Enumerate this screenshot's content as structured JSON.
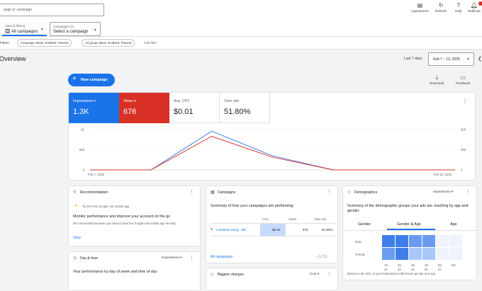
{
  "header": {
    "search_placeholder": "page or campaign",
    "view_selector": {
      "label": "View (2 filters)",
      "value": "All campaigns"
    },
    "campaigns_selector": {
      "label": "Campaigns (1)",
      "value": "Select a campaign"
    },
    "actions": [
      {
        "label": "Appearance",
        "icon": "appearance-icon"
      },
      {
        "label": "Refresh",
        "icon": "refresh-icon"
      },
      {
        "label": "Help",
        "icon": "help-icon"
      },
      {
        "label": "Notificati",
        "icon": "notifications-icon"
      }
    ]
  },
  "filters": {
    "label": "Filters",
    "chips": [
      "Campaign status: Enabled, Paused",
      "Ad group status: Enabled, Paused"
    ],
    "add_filter": "Add filter"
  },
  "overview": {
    "title": "Overview",
    "date_preset": "Last 7 days",
    "date_range": "Feb 7 – 13, 2025",
    "new_campaign": "New campaign",
    "download": "Download",
    "feedback": "Feedback"
  },
  "metrics": [
    {
      "label": "Impressions",
      "value": "1.3K"
    },
    {
      "label": "Views",
      "value": "676"
    },
    {
      "label": "Avg. CPV",
      "value": "$0.01"
    },
    {
      "label": "View rate",
      "value": "51.80%"
    }
  ],
  "chart_data": {
    "type": "line",
    "x": [
      "Feb 7, 2025",
      "Feb 8, 2025",
      "Feb 9, 2025",
      "Feb 10, 2025",
      "Feb 11, 2025",
      "Feb 12, 2025",
      "Feb 13, 2025"
    ],
    "x_tick_labels": [
      "Feb 7, 2025",
      "Feb 13, 2025"
    ],
    "left_ticks": [
      "1K",
      "500",
      "0"
    ],
    "right_ticks": [
      "600",
      "350",
      "0"
    ],
    "left_ylim": [
      0,
      1000
    ],
    "right_ylim": [
      0,
      600
    ],
    "series": [
      {
        "name": "Impressions",
        "axis": "left",
        "color": "#4285f4",
        "values": [
          0,
          0,
          960,
          350,
          0,
          0,
          0
        ]
      },
      {
        "name": "Views",
        "axis": "right",
        "color": "#d93025",
        "values": [
          0,
          0,
          500,
          190,
          0,
          0,
          0
        ]
      }
    ],
    "grid": true
  },
  "recommendation": {
    "title": "Recommendation",
    "tip": "Try the new Google Ads mobile app",
    "heading": "Monitor performance and improve your account on the go",
    "body": "Recommended because you haven't used the Google Ads mobile app recently",
    "action": "View"
  },
  "dayhour": {
    "title": "Day & hour",
    "metric": "Impressions",
    "heading": "Your performance by day of week and time of day"
  },
  "campaigns": {
    "title": "Campaigns",
    "heading": "Summary of how your campaigns are performing",
    "columns": [
      "Cost",
      "Views",
      "View rate"
    ],
    "rows": [
      {
        "name": "Carolines Song - 8/5",
        "cost": "$5.63",
        "views": "676",
        "view_rate": "51.80%"
      }
    ],
    "all_link": "All campaigns",
    "pagination": "1 / 1"
  },
  "changes": {
    "title": "Biggest changes",
    "metric": "Cost"
  },
  "demographics": {
    "title": "Demographics",
    "metric": "Impressions",
    "heading": "Summary of the demographic groups your ads are reaching by age and gender",
    "tabs": [
      "Gender",
      "Gender & Age",
      "Age"
    ],
    "rows": [
      "Male",
      "Female"
    ],
    "ages": [
      "18-24",
      "25-34",
      "35-44",
      "45-54",
      "55-64",
      "65+"
    ],
    "male": [
      3,
      3,
      2,
      2,
      0,
      0
    ],
    "female": [
      2,
      3,
      1,
      1,
      0,
      0
    ],
    "note": "Based on the 44% of your impressions with known gender and age."
  }
}
